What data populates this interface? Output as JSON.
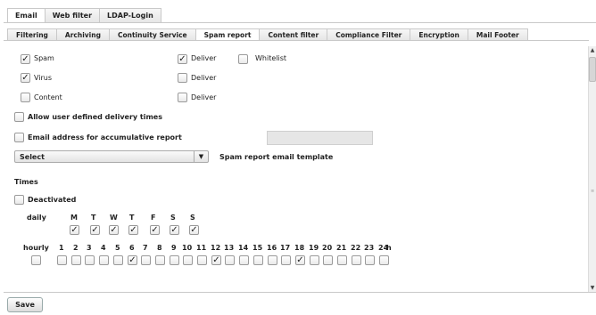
{
  "top_tabs": [
    "Email",
    "Web filter",
    "LDAP-Login"
  ],
  "sub_tabs": [
    "Filtering",
    "Archiving",
    "Continuity Service",
    "Spam report",
    "Content filter",
    "Compliance Filter",
    "Encryption",
    "Mail Footer"
  ],
  "rows": [
    {
      "label": "Spam",
      "checked": true,
      "deliver_label": "Deliver",
      "deliver_checked": true
    },
    {
      "label": "Virus",
      "checked": true,
      "deliver_label": "Deliver",
      "deliver_checked": false
    },
    {
      "label": "Content",
      "checked": false,
      "deliver_label": "Deliver",
      "deliver_checked": false
    }
  ],
  "whitelist_label": "Whitelist",
  "allow_user_times_label": "Allow user defined delivery times",
  "email_accum_label": "Email address for accumulative report",
  "email_accum_value": "",
  "template_select_value": "Select",
  "template_label": "Spam report email template",
  "times_heading": "Times",
  "deactivated_label": "Deactivated",
  "daily_label": "daily",
  "days": [
    "M",
    "T",
    "W",
    "T",
    "F",
    "S",
    "S"
  ],
  "days_checked": [
    true,
    true,
    true,
    true,
    true,
    true,
    true
  ],
  "hourly_label": "hourly",
  "hours": [
    "1",
    "2",
    "3",
    "4",
    "5",
    "6",
    "7",
    "8",
    "9",
    "10",
    "11",
    "12",
    "13",
    "14",
    "15",
    "16",
    "17",
    "18",
    "19",
    "20",
    "21",
    "22",
    "23",
    "24"
  ],
  "hours_checked": [
    false,
    false,
    false,
    false,
    false,
    true,
    false,
    false,
    false,
    false,
    false,
    true,
    false,
    false,
    false,
    false,
    false,
    true,
    false,
    false,
    false,
    false,
    false,
    false
  ],
  "hours_unit": "h",
  "check_glyph": "✓",
  "save_label": "Save"
}
